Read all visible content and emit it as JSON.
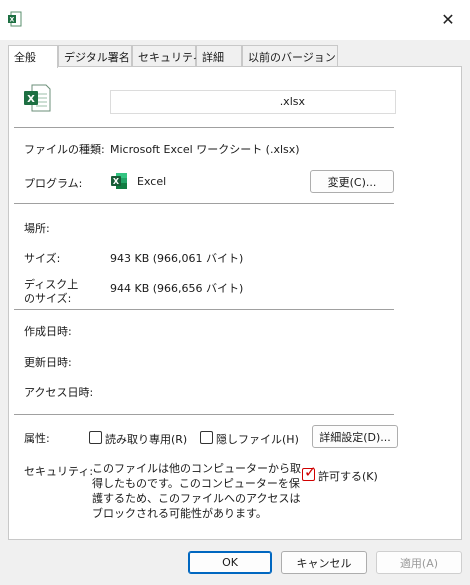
{
  "window": {
    "close_glyph": "✕"
  },
  "tabs": [
    {
      "label": "全般"
    },
    {
      "label": "デジタル署名"
    },
    {
      "label": "セキュリティ"
    },
    {
      "label": "詳細"
    },
    {
      "label": "以前のバージョン"
    }
  ],
  "file": {
    "name_suffix": ".xlsx"
  },
  "labels": {
    "file_type": "ファイルの種類:",
    "program": "プログラム:",
    "location": "場所:",
    "size": "サイズ:",
    "size_on_disk_line1": "ディスク上",
    "size_on_disk_line2": "のサイズ:",
    "created": "作成日時:",
    "modified": "更新日時:",
    "accessed": "アクセス日時:",
    "attributes": "属性:",
    "security": "セキュリティ:"
  },
  "values": {
    "file_type": "Microsoft Excel ワークシート (.xlsx)",
    "program": "Excel",
    "size": "943 KB (966,061 バイト)",
    "size_on_disk": "944 KB (966,656 バイト)"
  },
  "buttons": {
    "change": "変更(C)...",
    "advanced": "詳細設定(D)...",
    "ok": "OK",
    "cancel": "キャンセル",
    "apply": "適用(A)"
  },
  "attributes": {
    "readonly": {
      "label": "読み取り専用(R)",
      "checked": false
    },
    "hidden": {
      "label": "隠しファイル(H)",
      "checked": false
    }
  },
  "security": {
    "message": "このファイルは他のコンピューターから取得したものです。このコンピューターを保護するため、このファイルへのアクセスはブロックされる可能性があります。",
    "allow_label": "許可する(K)",
    "allow_checked": true
  },
  "colors": {
    "excel_green": "#1d6f42",
    "primary_border": "#0067c0",
    "check_red": "#d00000"
  },
  "icons": {
    "title": "excel-file-icon",
    "file": "excel-document-icon",
    "program": "excel-app-icon",
    "close": "close-icon"
  }
}
